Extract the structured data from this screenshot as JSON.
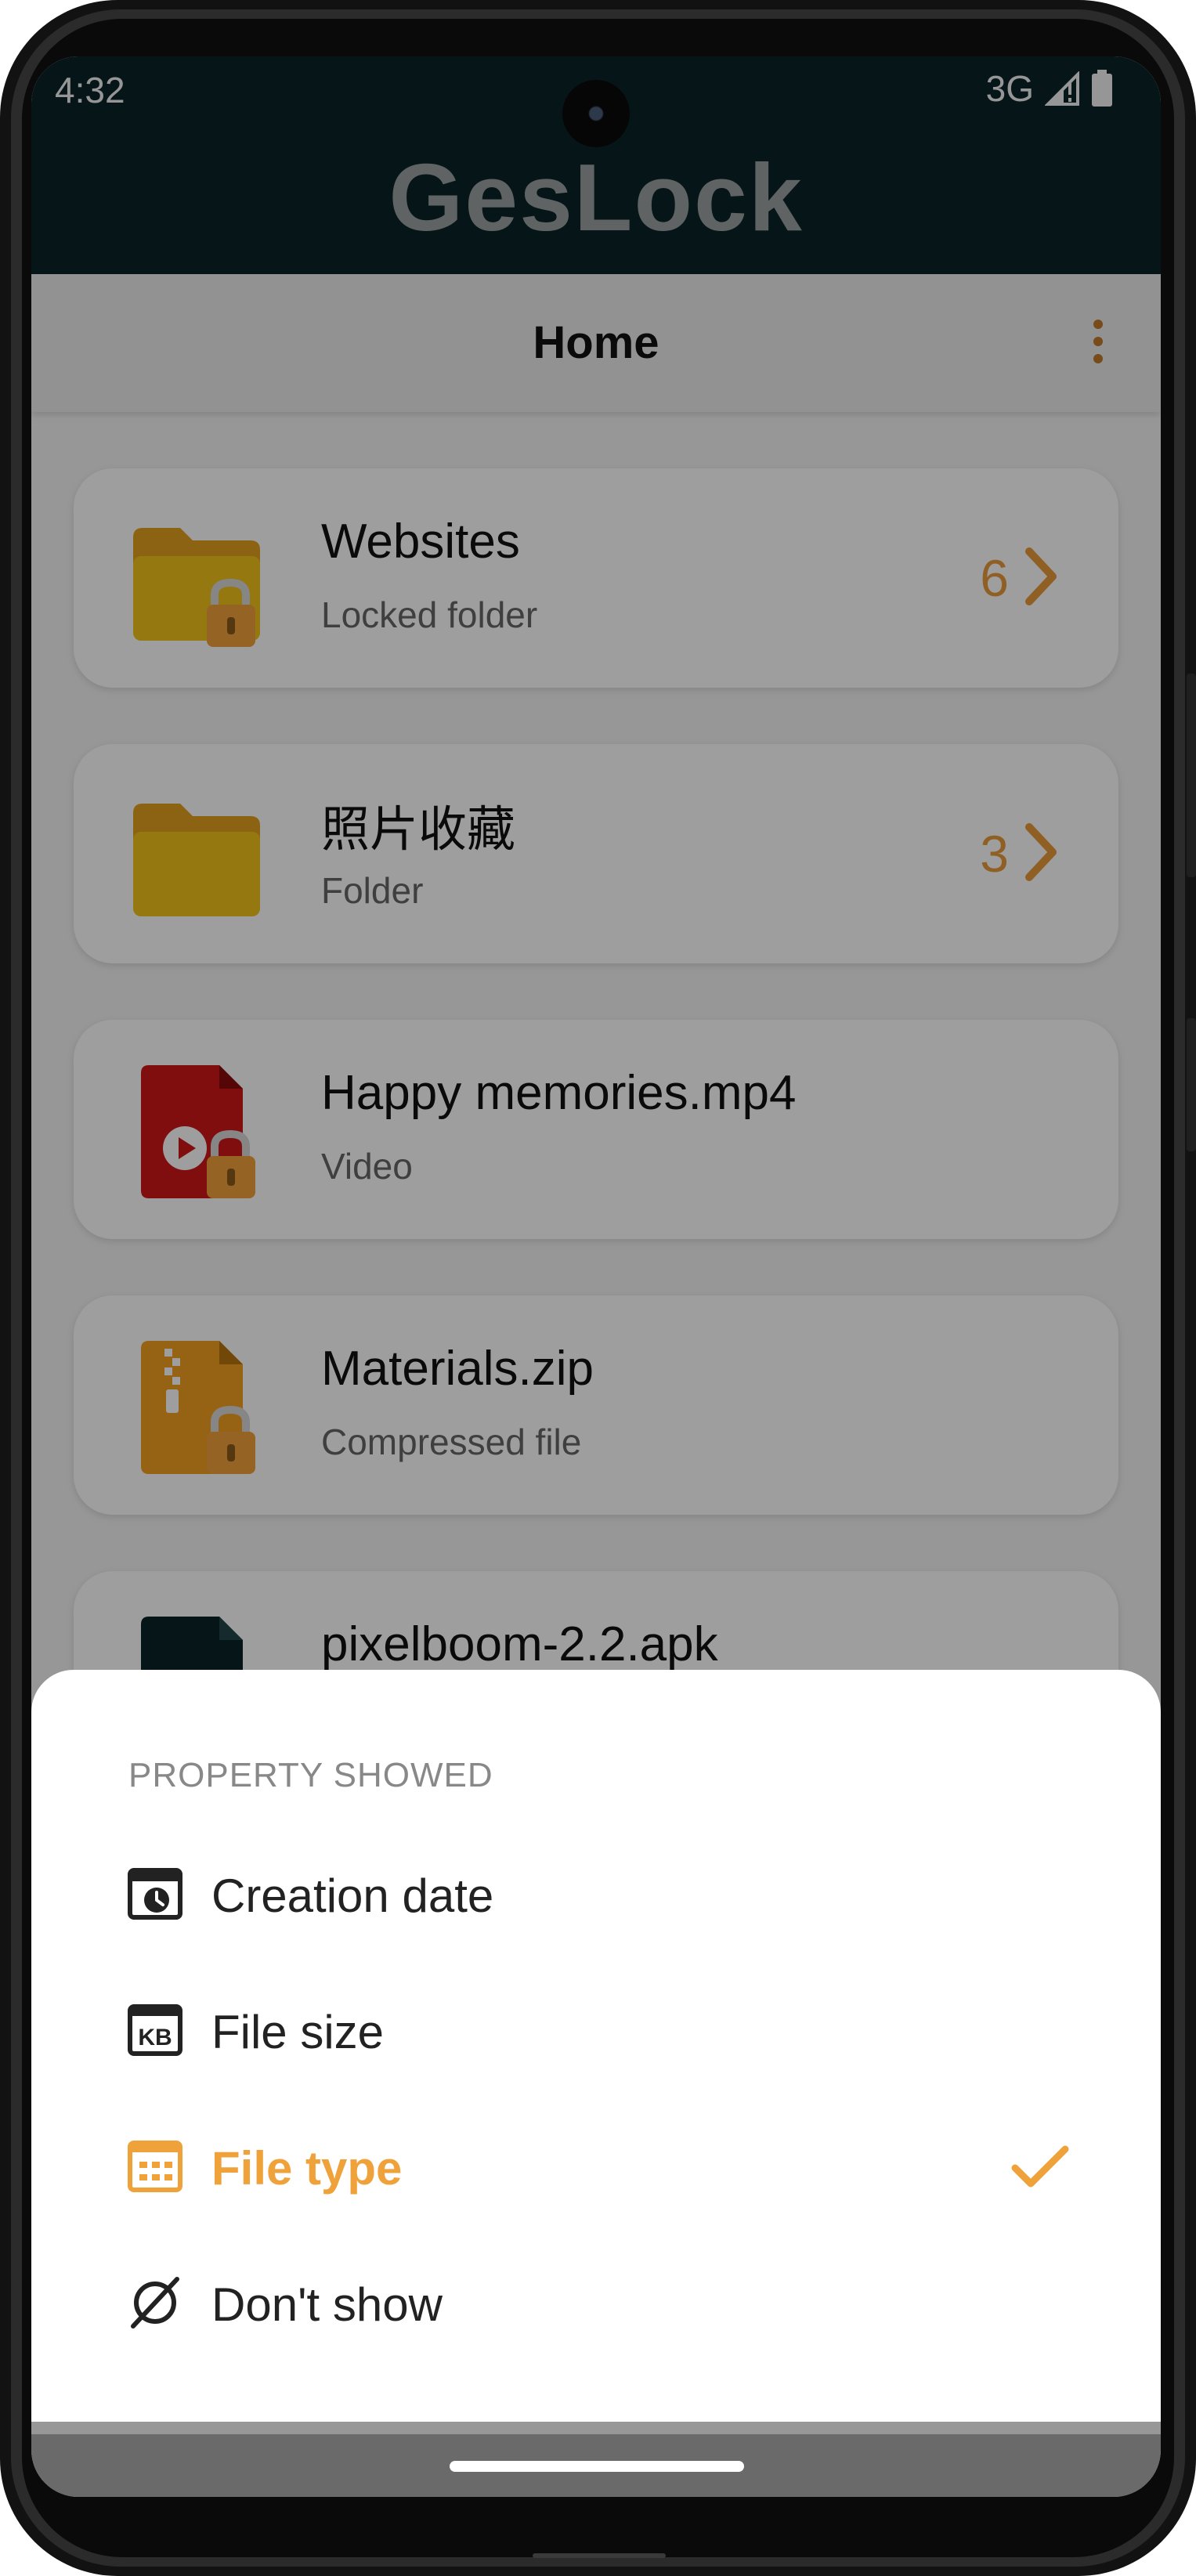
{
  "status_bar": {
    "time": "4:32",
    "network": "3G"
  },
  "app": {
    "brand": "GesLock",
    "toolbar_title": "Home"
  },
  "items": [
    {
      "title": "Websites",
      "subtitle": "Locked folder",
      "count": "6",
      "icon": "locked-folder-icon"
    },
    {
      "title": "照片收藏",
      "subtitle": "Folder",
      "count": "3",
      "icon": "folder-icon"
    },
    {
      "title": "Happy memories.mp4",
      "subtitle": "Video",
      "count": "",
      "icon": "locked-video-file-icon"
    },
    {
      "title": "Materials.zip",
      "subtitle": "Compressed file",
      "count": "",
      "icon": "locked-zip-file-icon"
    },
    {
      "title": "pixelboom-2.2.apk",
      "subtitle": "",
      "count": "",
      "icon": "apk-file-icon"
    }
  ],
  "sheet": {
    "header": "PROPERTY SHOWED",
    "options": [
      {
        "label": "Creation date",
        "icon": "calendar-clock-icon",
        "selected": false
      },
      {
        "label": "File size",
        "icon": "kb-icon",
        "selected": false
      },
      {
        "label": "File type",
        "icon": "file-type-icon",
        "selected": true
      },
      {
        "label": "Don't show",
        "icon": "empty-set-icon",
        "selected": false
      }
    ]
  },
  "colors": {
    "accent": "#f0a23a",
    "topbar": "#0a2328",
    "count": "#e79a3a",
    "folder": "#f2c21a",
    "folder_tab": "#e2a020",
    "video_file": "#d01818",
    "zip_file": "#f0a020",
    "apk_file": "#0a2328"
  }
}
